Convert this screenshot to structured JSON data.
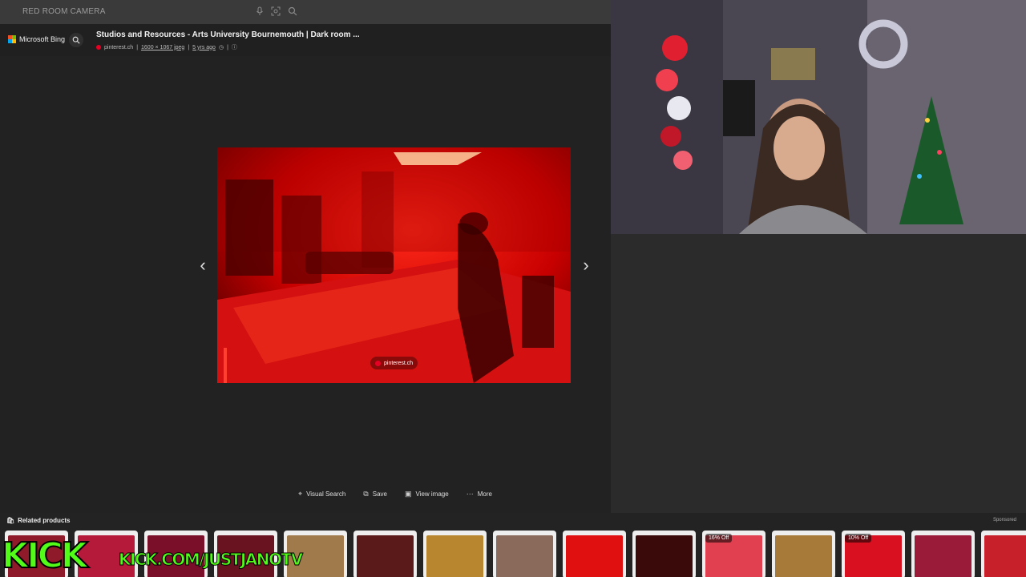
{
  "search_bar": {
    "query": "RED ROOM CAMERA",
    "icons": [
      "microphone-icon",
      "visual-search-icon",
      "search-icon"
    ]
  },
  "header": {
    "brand": "Microsoft Bing",
    "title": "Studios and Resources - Arts University Bournemouth | Dark room ...",
    "source": "pinterest.ch",
    "dimensions": "1600 × 1067 jpeg",
    "age": "5 yrs ago"
  },
  "viewer": {
    "source_chip": "pinterest.ch",
    "prev_glyph": "‹",
    "next_glyph": "›",
    "actions": [
      {
        "icon": "visual-search-icon",
        "glyph": "⌖",
        "label": "Visual Search"
      },
      {
        "icon": "save-icon",
        "glyph": "⧉",
        "label": "Save"
      },
      {
        "icon": "image-icon",
        "glyph": "▣",
        "label": "View image"
      },
      {
        "icon": "more-icon",
        "glyph": "⋯",
        "label": "More"
      }
    ]
  },
  "related": {
    "heading": "Related products",
    "sponsored": "Sponsored",
    "thumbs": [
      {
        "color": "#8e1a2a",
        "badge": ""
      },
      {
        "color": "#b51a3a",
        "badge": ""
      },
      {
        "color": "#7a0f2a",
        "badge": ""
      },
      {
        "color": "#6a1320",
        "badge": ""
      },
      {
        "color": "#a07a4a",
        "badge": ""
      },
      {
        "color": "#5a1a1a",
        "badge": ""
      },
      {
        "color": "#b8862e",
        "badge": ""
      },
      {
        "color": "#8a6a5a",
        "badge": ""
      },
      {
        "color": "#e01010",
        "badge": ""
      },
      {
        "color": "#3a0a0a",
        "badge": ""
      },
      {
        "color": "#e04050",
        "badge": "16% Off"
      },
      {
        "color": "#a87a3a",
        "badge": ""
      },
      {
        "color": "#d81020",
        "badge": "10% Off"
      },
      {
        "color": "#9a1a3a",
        "badge": ""
      },
      {
        "color": "#c8202a",
        "badge": ""
      }
    ]
  },
  "overlay": {
    "brand": "KICK",
    "url": "KICK.COM/JUSTJANOTV"
  },
  "colors": {
    "kick_green": "#53fc18",
    "bing_bg": "#202020",
    "accent_red": "#e60023"
  }
}
